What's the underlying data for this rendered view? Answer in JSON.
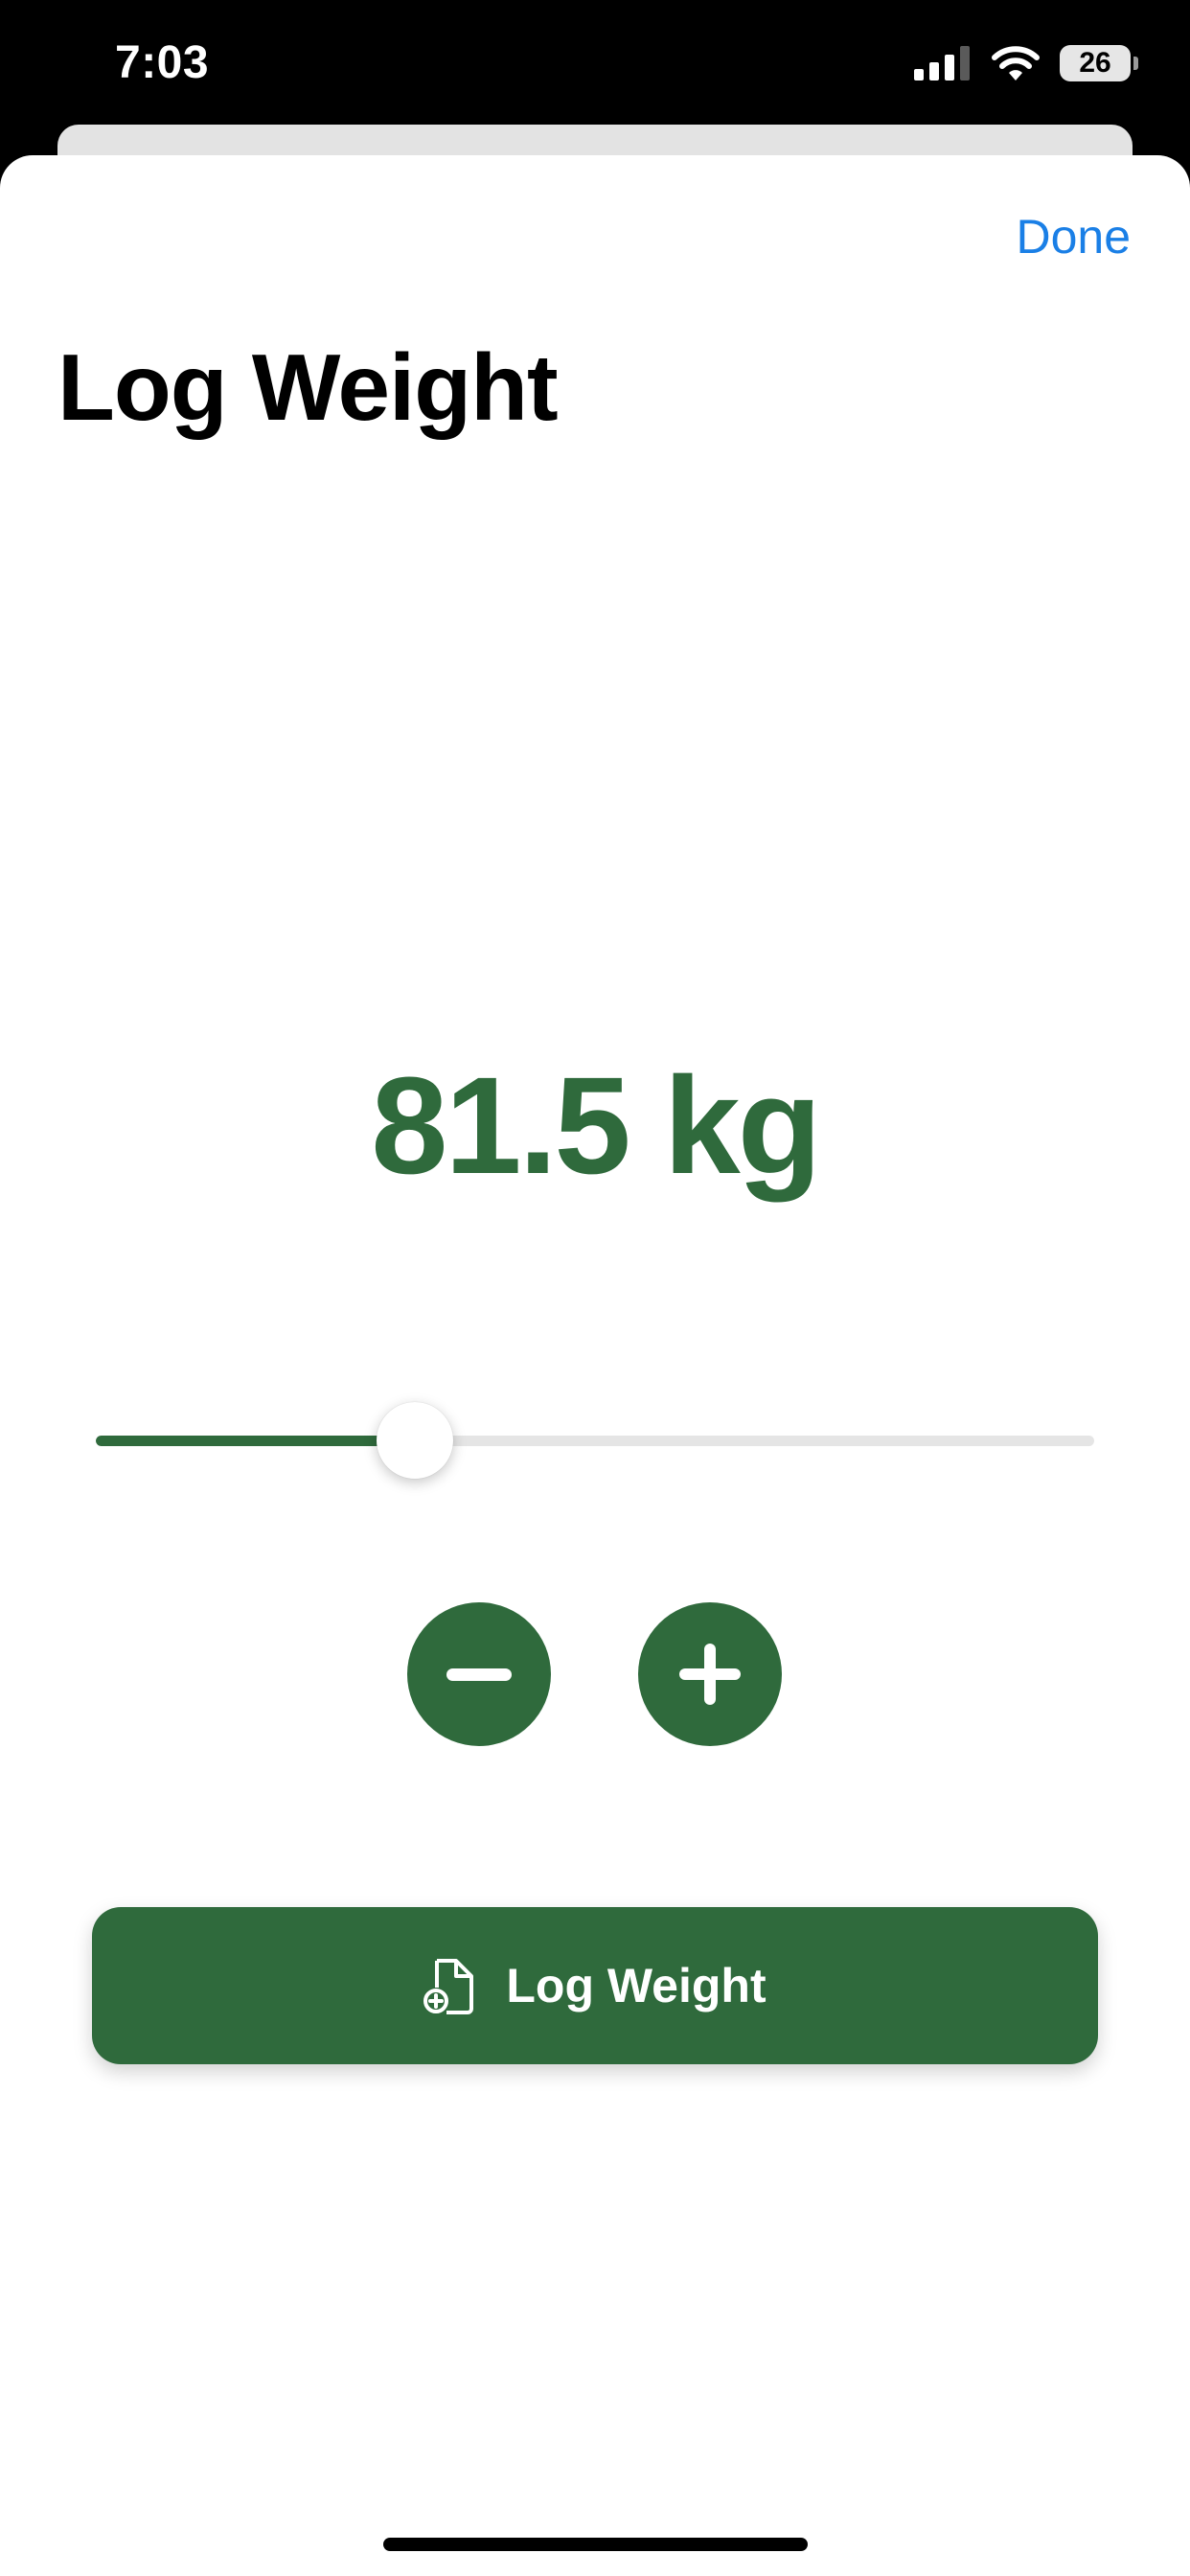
{
  "status_bar": {
    "time": "7:03",
    "battery_level": "26",
    "icons": [
      "cellular-signal-icon",
      "wifi-icon",
      "battery-icon"
    ]
  },
  "sheet": {
    "done_label": "Done",
    "title": "Log Weight"
  },
  "weight": {
    "display": "81.5 kg",
    "slider_fraction": 0.32
  },
  "stepper": {
    "icons": [
      "minus-icon",
      "plus-icon"
    ]
  },
  "log_button": {
    "label": "Log Weight",
    "icon": "document-add-icon"
  },
  "colors": {
    "accent_green": "#2f6a3c",
    "link_blue": "#1a7fe6",
    "track_gray": "#e5e5e5"
  }
}
